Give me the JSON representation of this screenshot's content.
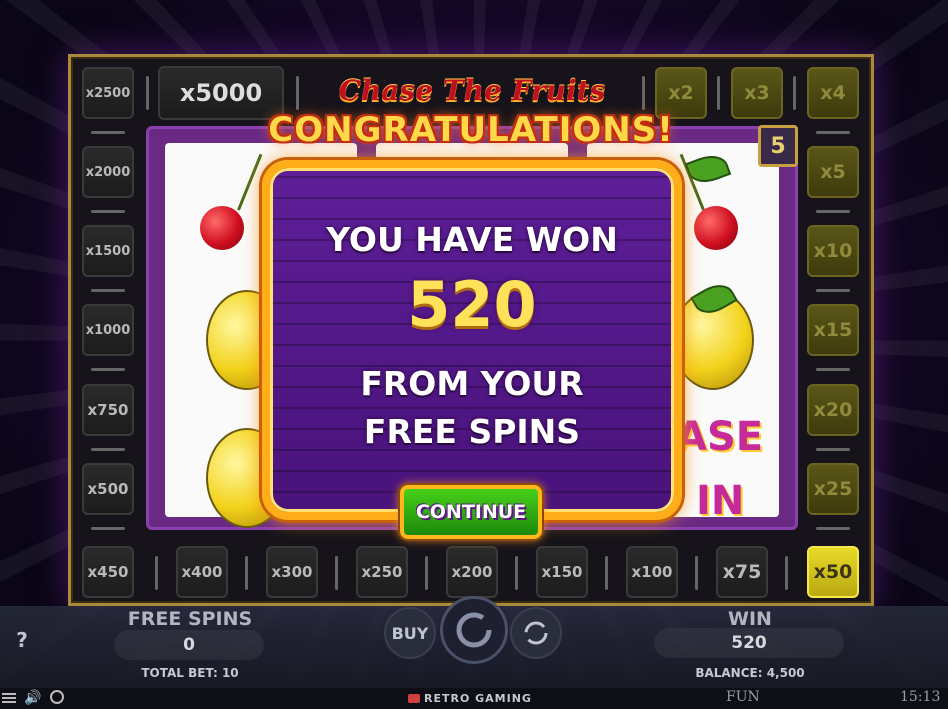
{
  "game": {
    "title": "Chase The Fruits",
    "level": "5",
    "top_multiplier": "x5000"
  },
  "left_column": [
    "x2500",
    "x2000",
    "x1500",
    "x1000",
    "x750",
    "x500"
  ],
  "bottom_row": [
    "x450",
    "x400",
    "x300",
    "x250",
    "x200",
    "x150",
    "x100",
    "x75",
    "x50"
  ],
  "top_right_row": [
    "x2",
    "x3",
    "x4"
  ],
  "right_column": [
    "x5",
    "x10",
    "x15",
    "x20",
    "x25"
  ],
  "reel_text": {
    "line1": "ASE",
    "line2": "IN"
  },
  "popup": {
    "header": "CONGRATULATIONS!",
    "line1": "YOU HAVE WON",
    "amount": "520",
    "line2": "FROM YOUR",
    "line3": "FREE SPINS",
    "continue_label": "CONTINUE"
  },
  "hud": {
    "free_spins_label": "FREE SPINS",
    "free_spins_value": "0",
    "total_bet": "TOTAL BET: 10",
    "buy_label": "BUY",
    "win_label": "WIN",
    "win_value": "520",
    "balance": "BALANCE: 4,500",
    "help_label": "?"
  },
  "footer": {
    "brand": "RETRO GAMING",
    "mode": "FUN",
    "time": "15:13"
  },
  "colors": {
    "accent_gold": "#ffae1a",
    "modal_purple": "#5e1e98",
    "continue_green": "#46d01a",
    "lit_cell": "#e8da2a"
  }
}
